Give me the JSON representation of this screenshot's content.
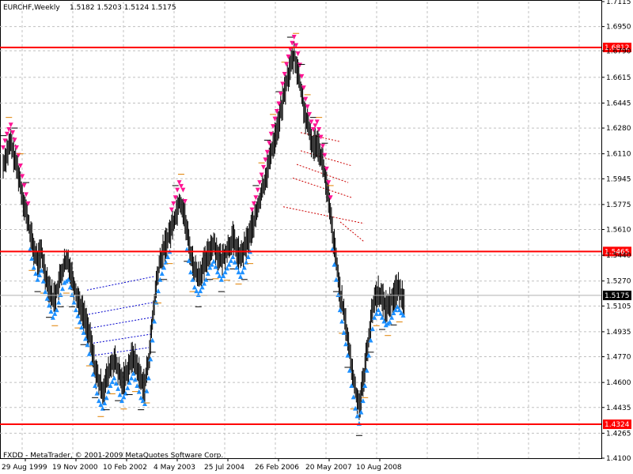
{
  "header": {
    "title": "EURCHF,Weekly",
    "ohlc": "1.5182 1.5203 1.5124 1.5175"
  },
  "footer": {
    "copyright": "FXDD - MetaTrader, © 2001-2009 MetaQuotes Software Corp."
  },
  "colors": {
    "background": "#ffffff",
    "grid": "#c0c0c0",
    "candle": "#000000",
    "hline": "#ff0000",
    "price_marker_bg": "#000000",
    "sell_arrow": "#ff1493",
    "buy_arrow": "#1e90ff",
    "sell_trend": "#cc0000",
    "buy_trend": "#0000cc",
    "dash_orange": "#e08000",
    "dash_black": "#000000"
  },
  "chart_data": {
    "type": "candlestick",
    "symbol": "EURCHF",
    "timeframe": "Weekly",
    "ylim": [
      1.41,
      1.7115
    ],
    "yticks": [
      1.7115,
      1.695,
      1.679,
      1.6615,
      1.6445,
      1.628,
      1.611,
      1.5945,
      1.5775,
      1.561,
      1.544,
      1.527,
      1.5105,
      1.4935,
      1.477,
      1.46,
      1.4435,
      1.4265,
      1.41
    ],
    "ytick_labels": [
      "1.7115",
      "1.6950",
      "1.6790",
      "1.6615",
      "1.6445",
      "1.6280",
      "1.6110",
      "1.5945",
      "1.5775",
      "1.5610",
      "1.5440",
      "1.5270",
      "1.5105",
      "1.4935",
      "1.4770",
      "1.4600",
      "1.4435",
      "1.4265",
      "1.4100"
    ],
    "xticks": [
      "29 Aug 1999",
      "19 Nov 2000",
      "10 Feb 2002",
      "4 May 2003",
      "25 Jul 2004",
      "26 Feb 2006",
      "20 May 2007",
      "10 Aug 2008"
    ],
    "hlines": [
      {
        "label": "1.6812",
        "value": 1.6812
      },
      {
        "label": "1.5465",
        "value": 1.5465
      },
      {
        "label": "1.4324",
        "value": 1.4324
      }
    ],
    "current_price": {
      "label": "1.5175",
      "value": 1.5175
    },
    "price_series": [
      1.603,
      1.612,
      1.618,
      1.608,
      1.598,
      1.584,
      1.572,
      1.56,
      1.548,
      1.54,
      1.546,
      1.532,
      1.523,
      1.515,
      1.52,
      1.53,
      1.538,
      1.54,
      1.53,
      1.52,
      1.512,
      1.505,
      1.497,
      1.485,
      1.47,
      1.46,
      1.455,
      1.462,
      1.47,
      1.475,
      1.468,
      1.46,
      1.465,
      1.472,
      1.478,
      1.47,
      1.462,
      1.458,
      1.475,
      1.5,
      1.525,
      1.54,
      1.548,
      1.555,
      1.562,
      1.57,
      1.58,
      1.575,
      1.56,
      1.545,
      1.535,
      1.53,
      1.535,
      1.54,
      1.548,
      1.552,
      1.545,
      1.54,
      1.545,
      1.55,
      1.555,
      1.548,
      1.542,
      1.548,
      1.555,
      1.562,
      1.57,
      1.58,
      1.59,
      1.6,
      1.612,
      1.622,
      1.632,
      1.645,
      1.658,
      1.668,
      1.676,
      1.665,
      1.65,
      1.635,
      1.625,
      1.615,
      1.62,
      1.61,
      1.598,
      1.58,
      1.56,
      1.54,
      1.52,
      1.505,
      1.49,
      1.47,
      1.455,
      1.445,
      1.46,
      1.48,
      1.5,
      1.515,
      1.52,
      1.515,
      1.51,
      1.512,
      1.518,
      1.522,
      1.518,
      1.515
    ]
  }
}
